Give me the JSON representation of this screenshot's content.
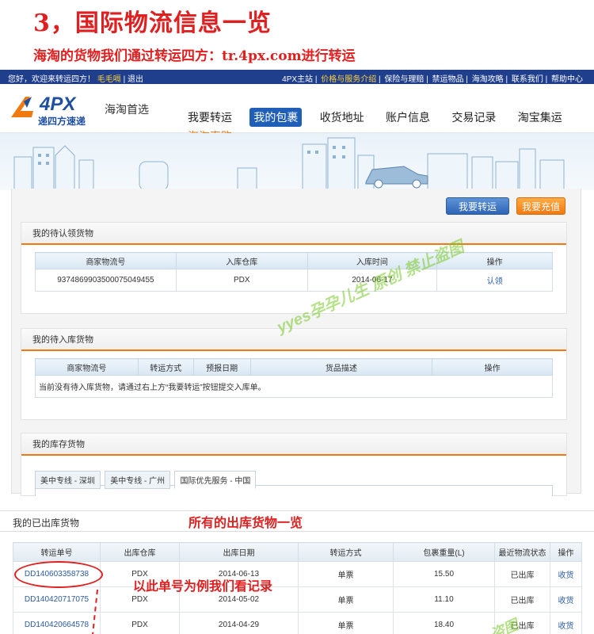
{
  "heading": "3，国际物流信息一览",
  "subheading": "海淘的货物我们通过转运四方：tr.4px.com进行转运",
  "topbar": {
    "welcome": "您好，欢迎来转运四方！",
    "username": "毛毛嗝",
    "logout": "| 退出",
    "links": [
      "4PX主站",
      "价格与服务介绍",
      "保险与理赔",
      "禁运物品",
      "海淘攻略",
      "联系我们",
      "帮助中心"
    ]
  },
  "logo": {
    "brand": "4PX",
    "sub": "递四方速递",
    "slogan": "海淘首选"
  },
  "nav": [
    "我要转运",
    "我的包裹",
    "收货地址",
    "账户信息",
    "交易记录",
    "淘宝集运",
    "海淘直购"
  ],
  "buttons": {
    "transfer": "我要转运",
    "recharge": "我要充值"
  },
  "section_pending_claim": {
    "title": "我的待认领货物",
    "headers": [
      "商家物流号",
      "入库仓库",
      "入库时间",
      "操作"
    ],
    "row": [
      "9374869903500075049455",
      "PDX",
      "2014-06-17",
      "认领"
    ]
  },
  "section_pending_inbound": {
    "title": "我的待入库货物",
    "headers": [
      "商家物流号",
      "转运方式",
      "预报日期",
      "货品描述",
      "操作"
    ],
    "empty_note": "当前没有待入库货物，请通过右上方“我要转运”按钮提交入库单。"
  },
  "section_stock": {
    "title": "我的库存货物",
    "tabs": [
      "美中专线 - 深圳",
      "美中专线 - 广州",
      "国际优先服务 - 中国"
    ]
  },
  "section_shipped": {
    "title": "我的已出库货物",
    "annotation_title": "所有的出库货物一览",
    "annotation_example": "以此单号为例我们看记录",
    "headers": [
      "转运单号",
      "出库仓库",
      "出库日期",
      "转运方式",
      "包裹重量(L)",
      "最近物流状态",
      "操作"
    ],
    "rows": [
      [
        "DD140603358738",
        "PDX",
        "2014-06-13",
        "单票",
        "15.50",
        "已出库",
        "收货"
      ],
      [
        "DD140420717075",
        "PDX",
        "2014-05-02",
        "单票",
        "11.10",
        "已出库",
        "收货"
      ],
      [
        "DD140420664578",
        "PDX",
        "2014-04-29",
        "单票",
        "18.40",
        "已出库",
        "收货"
      ]
    ]
  },
  "watermarks": [
    "yyes孕孕儿生 原创 禁止盗图",
    "盗图"
  ]
}
